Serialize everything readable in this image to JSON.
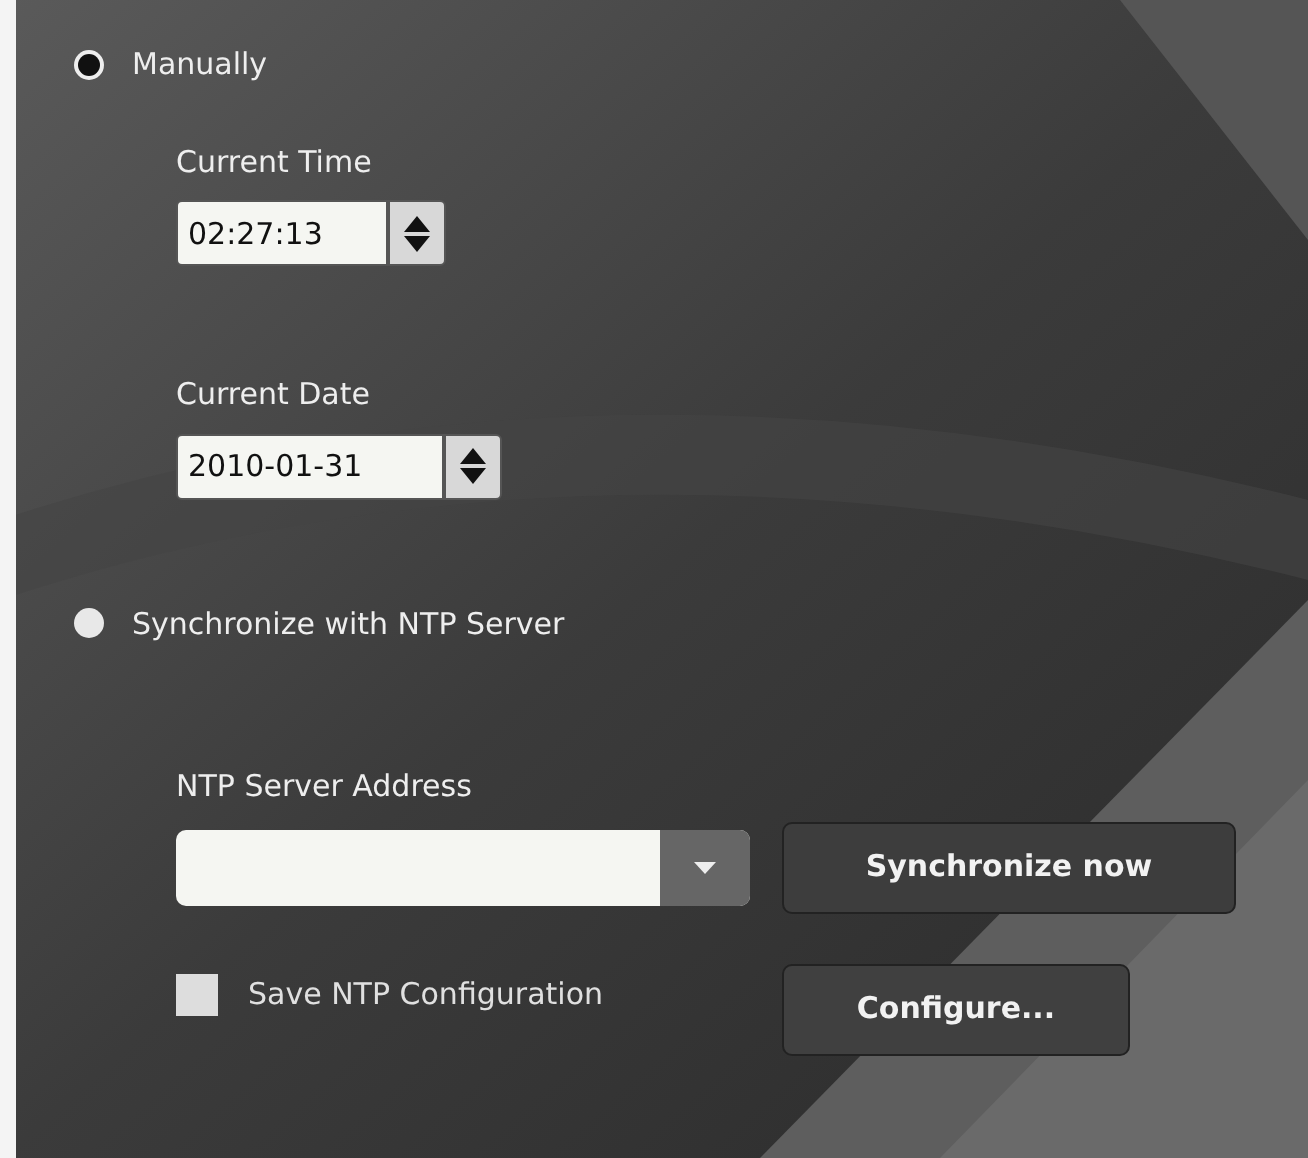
{
  "time_mode": [
    {
      "label": "Manually",
      "selected": true
    },
    {
      "label": "Synchronize with NTP Server",
      "selected": false
    }
  ],
  "current_time": {
    "label": "Current Time",
    "value": "02:27:13"
  },
  "current_date": {
    "label": "Current Date",
    "value": "2010-01-31"
  },
  "ntp": {
    "label": "NTP Server Address",
    "save_config": {
      "label": "Save NTP Configuration",
      "checked": false
    }
  },
  "buttons": [
    "Synchronize now",
    "Configure..."
  ]
}
